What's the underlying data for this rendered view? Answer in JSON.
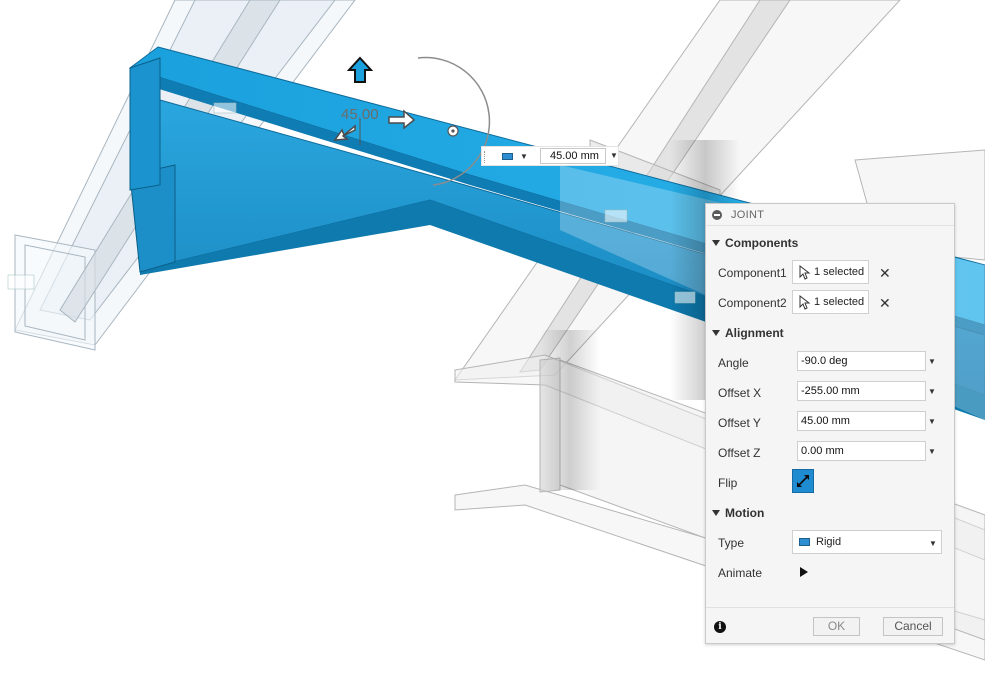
{
  "viewport": {
    "angle_readout": "45.00",
    "manipulator_value": "45.00 mm",
    "colors": {
      "selected_part": "#1ca3dd",
      "ghost_part": "#b9b9b9"
    }
  },
  "joint_dialog": {
    "title": "JOINT",
    "components": {
      "heading": "Components",
      "component1": {
        "label": "Component1",
        "value": "1 selected"
      },
      "component2": {
        "label": "Component2",
        "value": "1 selected"
      }
    },
    "alignment": {
      "heading": "Alignment",
      "angle": {
        "label": "Angle",
        "value": "-90.0 deg"
      },
      "offset_x": {
        "label": "Offset X",
        "value": "-255.00 mm"
      },
      "offset_y": {
        "label": "Offset Y",
        "value": "45.00 mm"
      },
      "offset_z": {
        "label": "Offset Z",
        "value": "0.00 mm"
      },
      "flip": {
        "label": "Flip"
      }
    },
    "motion": {
      "heading": "Motion",
      "type": {
        "label": "Type",
        "value": "Rigid"
      },
      "animate": {
        "label": "Animate"
      }
    },
    "footer": {
      "ok": "OK",
      "cancel": "Cancel"
    },
    "accent_color": "#1f8bd1"
  }
}
